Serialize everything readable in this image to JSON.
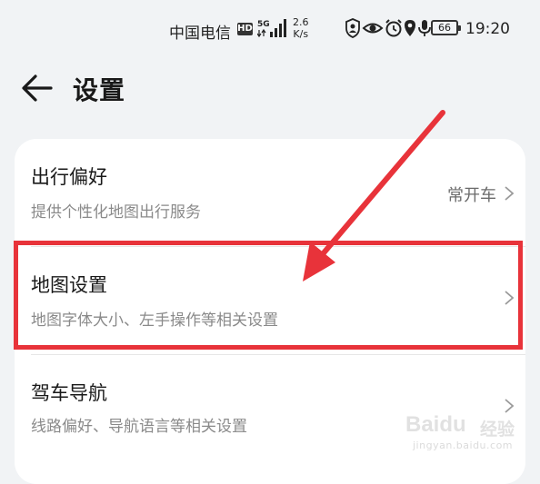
{
  "status_bar": {
    "carrier": "中国电信",
    "hd_badge": "HD",
    "network": "5G",
    "speed_value": "2.6",
    "speed_unit": "K/s",
    "battery": "66",
    "time": "19:20",
    "icons": [
      "user-shield-icon",
      "eye-icon",
      "alarm-icon",
      "location-icon",
      "microphone-icon"
    ]
  },
  "header": {
    "title": "设置",
    "back_icon": "back-arrow-icon"
  },
  "settings": {
    "items": [
      {
        "title": "出行偏好",
        "subtitle": "提供个性化地图出行服务",
        "value": "常开车"
      },
      {
        "title": "地图设置",
        "subtitle": "地图字体大小、左手操作等相关设置",
        "value": ""
      },
      {
        "title": "驾车导航",
        "subtitle": "线路偏好、导航语言等相关设置",
        "value": ""
      }
    ]
  },
  "annotation": {
    "highlight_color": "#e8333a"
  },
  "watermark": {
    "brand": "Baidu",
    "brand_cn": "经验",
    "url": "jingyan.baidu.com"
  }
}
